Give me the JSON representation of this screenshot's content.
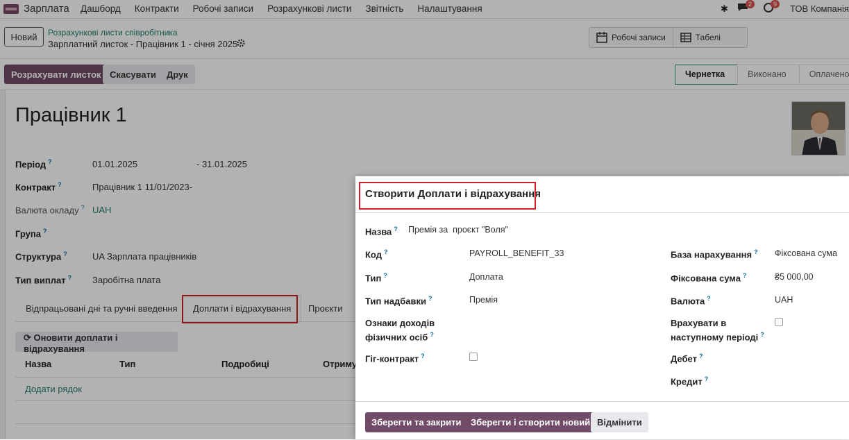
{
  "navbar": {
    "app_name": "Зарплата",
    "menu": [
      "Дашборд",
      "Контракти",
      "Робочі записи",
      "Розрахункові листи",
      "Звітність",
      "Налаштування"
    ],
    "messages_count": "2",
    "activities_count": "9",
    "company": "ТОВ Компанія,"
  },
  "control": {
    "new_label": "Новий",
    "breadcrumb_parent": "Розрахункові листи співробітника",
    "breadcrumb_current": "Зарплатний листок - Працівник 1 - січня 2025",
    "work_entries_label": "Робочі записи",
    "timesheets_label": "Табелі"
  },
  "statusbar": {
    "compute_label": "Розрахувати листок",
    "cancel_label": "Скасувати",
    "print_label": "Друк",
    "stages": [
      "Чернетка",
      "Виконано",
      "Оплачено"
    ]
  },
  "form": {
    "employee": "Працівник 1",
    "period_label": "Період",
    "period_from": "01.01.2025",
    "period_to": "- 31.01.2025",
    "contract_label": "Контракт",
    "contract_value": "Працівник 1 11/01/2023-",
    "currency_label": "Валюта окладу",
    "currency_value": "UAH",
    "group_label": "Група",
    "structure_label": "Структура",
    "structure_value": "UA Зарплата працівників",
    "paytype_label": "Тип виплат",
    "paytype_value": "Заробітна плата"
  },
  "tabs": [
    "Відпрацьовані дні та ручні введення",
    "Доплати і відрахування",
    "Проєкти"
  ],
  "lines": {
    "refresh_label": "Оновити доплати і відрахування",
    "columns": [
      "Назва",
      "Тип",
      "Подробиці",
      "Отриму"
    ],
    "add_line": "Додати рядок"
  },
  "dialog": {
    "title": "Створити Доплати і відрахування",
    "name_label": "Назва",
    "name_value": "Премія за  проєкт \"Воля\"",
    "code_label": "Код",
    "code_value": "PAYROLL_BENEFIT_33",
    "type_label": "Тип",
    "type_value": "Доплата",
    "allowance_label": "Тип надбавки",
    "allowance_value": "Премія",
    "income_label_1": "Ознаки доходів",
    "income_label_2": "фізичних осіб",
    "gig_label": "Гіг-контракт",
    "base_label": "База нарахування",
    "base_value": "Фіксована сума",
    "fixed_label": "Фіксована сума",
    "fixed_value": "₴5 000,00",
    "currency_label": "Валюта",
    "currency_value": "UAH",
    "next_period_label_1": "Врахувати в",
    "next_period_label_2": "наступному періоді",
    "debit_label": "Дебет",
    "credit_label": "Кредит",
    "save_close": "Зберегти та закрити",
    "save_new": "Зберегти і створити новий",
    "discard": "Відмінити"
  },
  "colors": {
    "primary": "#714b67",
    "link": "#237a6f",
    "highlight": "#d0202a"
  }
}
